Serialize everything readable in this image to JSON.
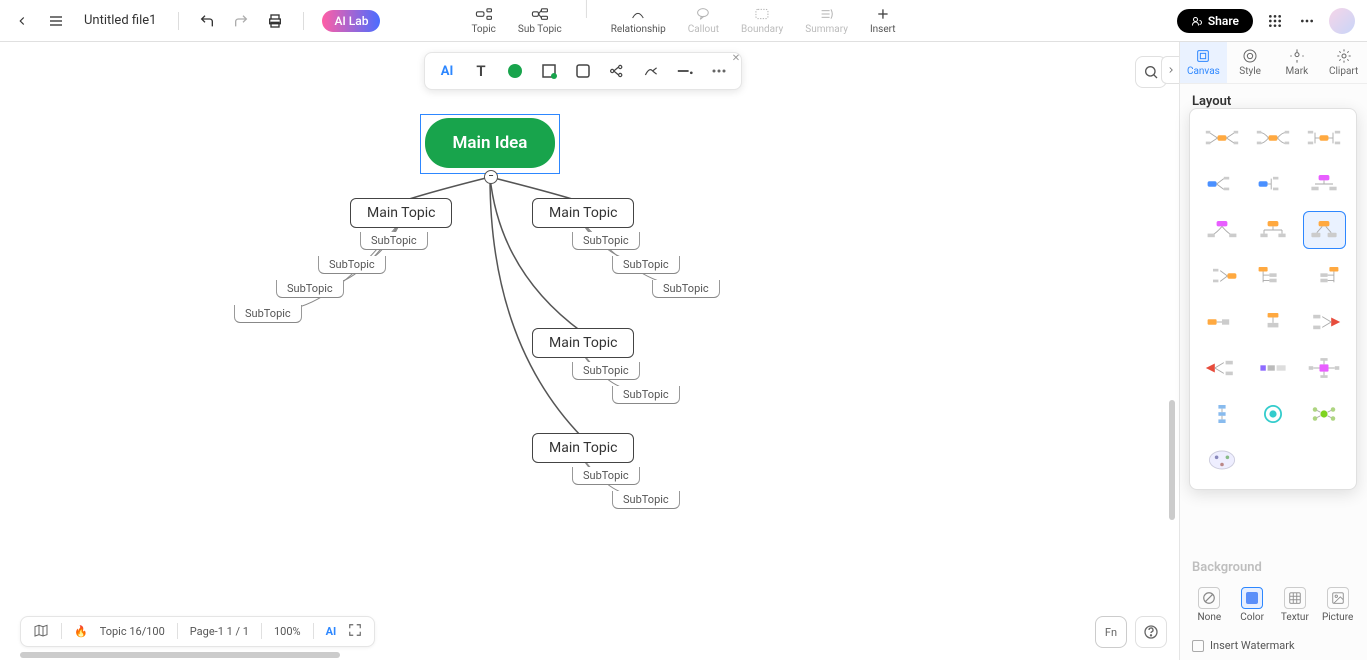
{
  "header": {
    "file_title": "Untitled file1",
    "ai_lab": "AI Lab",
    "center": [
      {
        "label": "Topic",
        "enabled": true
      },
      {
        "label": "Sub Topic",
        "enabled": true
      },
      {
        "label": "Relationship",
        "enabled": true
      },
      {
        "label": "Callout",
        "enabled": false
      },
      {
        "label": "Boundary",
        "enabled": false
      },
      {
        "label": "Summary",
        "enabled": false
      },
      {
        "label": "Insert",
        "enabled": true
      }
    ],
    "share": "Share"
  },
  "float_toolbar": {
    "ai": "AI"
  },
  "mindmap": {
    "main": "Main Idea",
    "collapse": "−",
    "topics": [
      {
        "label": "Main Topic",
        "subs": [
          "SubTopic",
          "SubTopic",
          "SubTopic",
          "SubTopic"
        ]
      },
      {
        "label": "Main Topic",
        "subs": [
          "SubTopic",
          "SubTopic",
          "SubTopic"
        ]
      },
      {
        "label": "Main Topic",
        "subs": [
          "SubTopic",
          "SubTopic"
        ]
      },
      {
        "label": "Main Topic",
        "subs": [
          "SubTopic",
          "SubTopic"
        ]
      }
    ]
  },
  "right": {
    "tabs": [
      {
        "label": "Canvas",
        "active": true
      },
      {
        "label": "Style",
        "active": false
      },
      {
        "label": "Mark",
        "active": false
      },
      {
        "label": "Clipart",
        "active": false
      }
    ],
    "layout_title": "Layout",
    "layout_label": "Layout",
    "background_title": "Background",
    "bg_options": [
      "None",
      "Color",
      "Textur",
      "Picture"
    ],
    "watermark": "Insert Watermark"
  },
  "bottom": {
    "topic_count": "Topic 16/100",
    "page": "Page-1  1 / 1",
    "zoom": "100%",
    "ai": "AI"
  }
}
